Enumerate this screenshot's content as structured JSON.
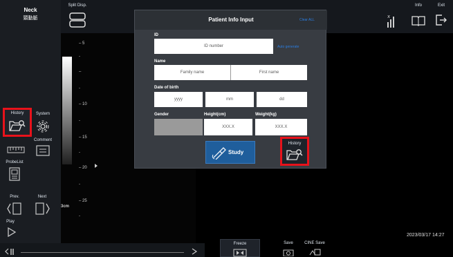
{
  "colors": {
    "accent_blue": "#2b7de0",
    "study_button": "#1f5e9c",
    "highlight_red": "#e8121b"
  },
  "topbar": {
    "probe_title": "Neck",
    "probe_subtitle": "頸動脈",
    "split_disp_label": "Split Disp.",
    "info_label": "Info",
    "exit_label": "Exit"
  },
  "left_panel": {
    "history_label": "History",
    "system_label": "System",
    "comment_label": "Comment",
    "probelist_label": "ProbeList",
    "prev_label": "Prev.",
    "next_label": "Next",
    "play_label": "Play"
  },
  "scale": {
    "ticks": [
      "5",
      "10",
      "15",
      "20",
      "25"
    ],
    "depth_label": "3cm"
  },
  "dialog": {
    "title": "Patient Info Input",
    "clear_all": "Clear ALL",
    "id_label": "ID",
    "id_placeholder": "ID number",
    "auto_generate": "Auto generate",
    "name_label": "Name",
    "family_name_placeholder": "Family name",
    "first_name_placeholder": "First name",
    "dob_label": "Date of birth",
    "dob_yyyy": "yyyy",
    "dob_mm": "mm",
    "dob_dd": "dd",
    "gender_label": "Gender",
    "height_label": "Height(cm)",
    "weight_label": "Weight(kg)",
    "height_placeholder": "XXX.X",
    "weight_placeholder": "XXX.X",
    "study_button": "Study",
    "history_label": "History"
  },
  "bottom": {
    "datetime": "2023/03/17 14:27",
    "freeze_label": "Freeze",
    "save_label": "Save",
    "cine_save_label": "CINE Save"
  }
}
